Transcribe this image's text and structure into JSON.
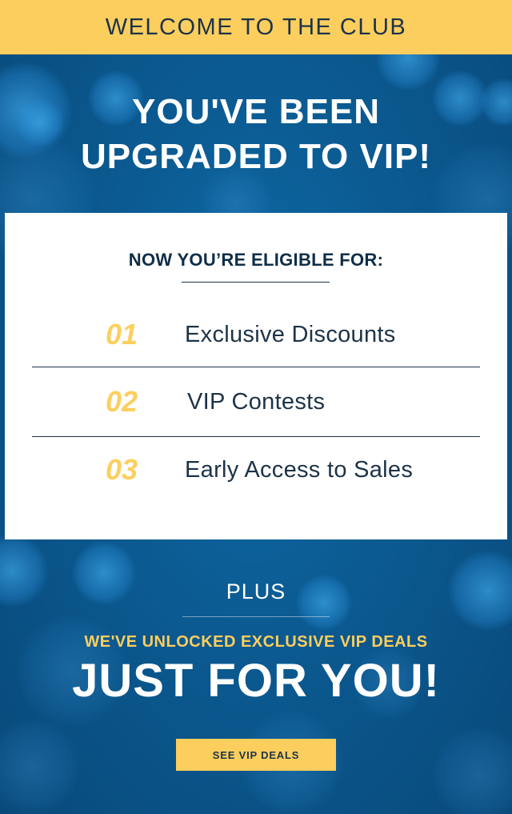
{
  "banner": {
    "text": "WELCOME TO THE CLUB"
  },
  "hero": {
    "line1": "YOU'VE BEEN",
    "line2": "UPGRADED TO VIP!"
  },
  "card": {
    "heading": "NOW YOU’RE ELIGIBLE FOR:",
    "benefits": [
      {
        "number": "01",
        "label": "Exclusive Discounts"
      },
      {
        "number": "02",
        "label": "VIP Contests"
      },
      {
        "number": "03",
        "label": "Early Access to Sales"
      }
    ]
  },
  "promo": {
    "plus": "PLUS",
    "unlocked": "WE'VE UNLOCKED EXCLUSIVE VIP DEALS",
    "headline": "JUST FOR YOU!",
    "cta_label": "SEE VIP DEALS"
  },
  "colors": {
    "accent_yellow": "#fcce5e",
    "navy": "#1d3348",
    "background_blue": "#0b5a91",
    "white": "#ffffff"
  }
}
